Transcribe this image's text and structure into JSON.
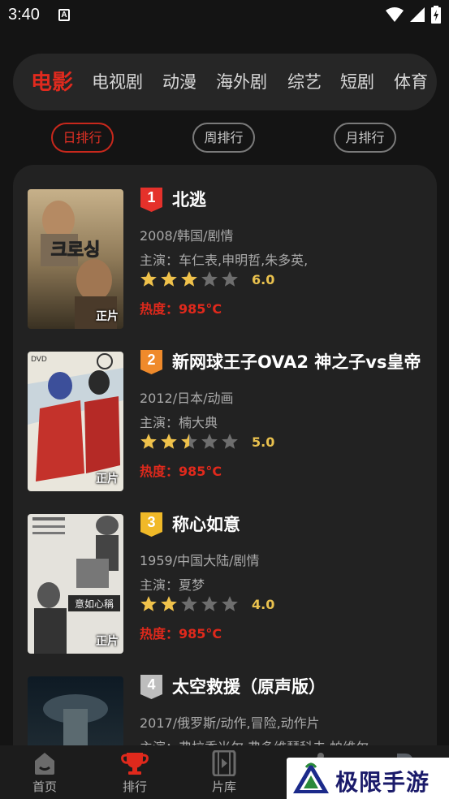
{
  "status": {
    "time": "3:40",
    "notif_glyph": "A"
  },
  "categories": {
    "tabs": [
      {
        "label": "电影",
        "active": true
      },
      {
        "label": "电视剧",
        "active": false
      },
      {
        "label": "动漫",
        "active": false
      },
      {
        "label": "海外剧",
        "active": false
      },
      {
        "label": "综艺",
        "active": false
      },
      {
        "label": "短剧",
        "active": false
      },
      {
        "label": "体育",
        "active": false
      }
    ]
  },
  "rank_periods": [
    {
      "label": "日排行",
      "active": true
    },
    {
      "label": "周排行",
      "active": false
    },
    {
      "label": "月排行",
      "active": false
    }
  ],
  "colors": {
    "accent": "#e02a1e",
    "rank1": "#e5312b",
    "rank2": "#ef8a2b",
    "rank3": "#f0b928",
    "rank4": "#bdbdbd",
    "star": "#f0c24b",
    "star_empty": "#6e6e6e"
  },
  "items": [
    {
      "rank": "1",
      "title": "北逃",
      "meta": "2008/韩国/剧情",
      "cast": "主演：车仁表,申明哲,朱多英,",
      "rating": 3,
      "score": "6.0",
      "heat": "热度：985°C",
      "badge": "正片",
      "poster_text": "크로싱"
    },
    {
      "rank": "2",
      "title": "新网球王子OVA2 神之子vs皇帝",
      "meta": "2012/日本/动画",
      "cast": "主演：楠大典",
      "rating": 2.5,
      "score": "5.0",
      "heat": "热度：985°C",
      "badge": "正片",
      "poster_text": "DVD"
    },
    {
      "rank": "3",
      "title": "称心如意",
      "meta": "1959/中国大陆/剧情",
      "cast": "主演：夏梦",
      "rating": 2,
      "score": "4.0",
      "heat": "热度：985°C",
      "badge": "正片",
      "poster_text": "意如心稱"
    },
    {
      "rank": "4",
      "title": "太空救援（原声版）",
      "meta": "2017/俄罗斯/动作,冒险,动作片",
      "cast": "主演：弗拉季米尔·弗多维琴科夫,帕维尔",
      "rating": 0,
      "score": "",
      "heat": "",
      "badge": "",
      "poster_text": ""
    }
  ],
  "bottom_nav": [
    {
      "label": "首页",
      "icon": "home-icon",
      "active": false
    },
    {
      "label": "排行",
      "icon": "trophy-icon",
      "active": true
    },
    {
      "label": "片库",
      "icon": "film-icon",
      "active": false
    },
    {
      "label": "",
      "icon": "share-icon",
      "active": false
    },
    {
      "label": "",
      "icon": "profile-icon",
      "active": false
    }
  ],
  "watermark": {
    "text": "极限手游网",
    "logo": "ji-logo-icon"
  }
}
